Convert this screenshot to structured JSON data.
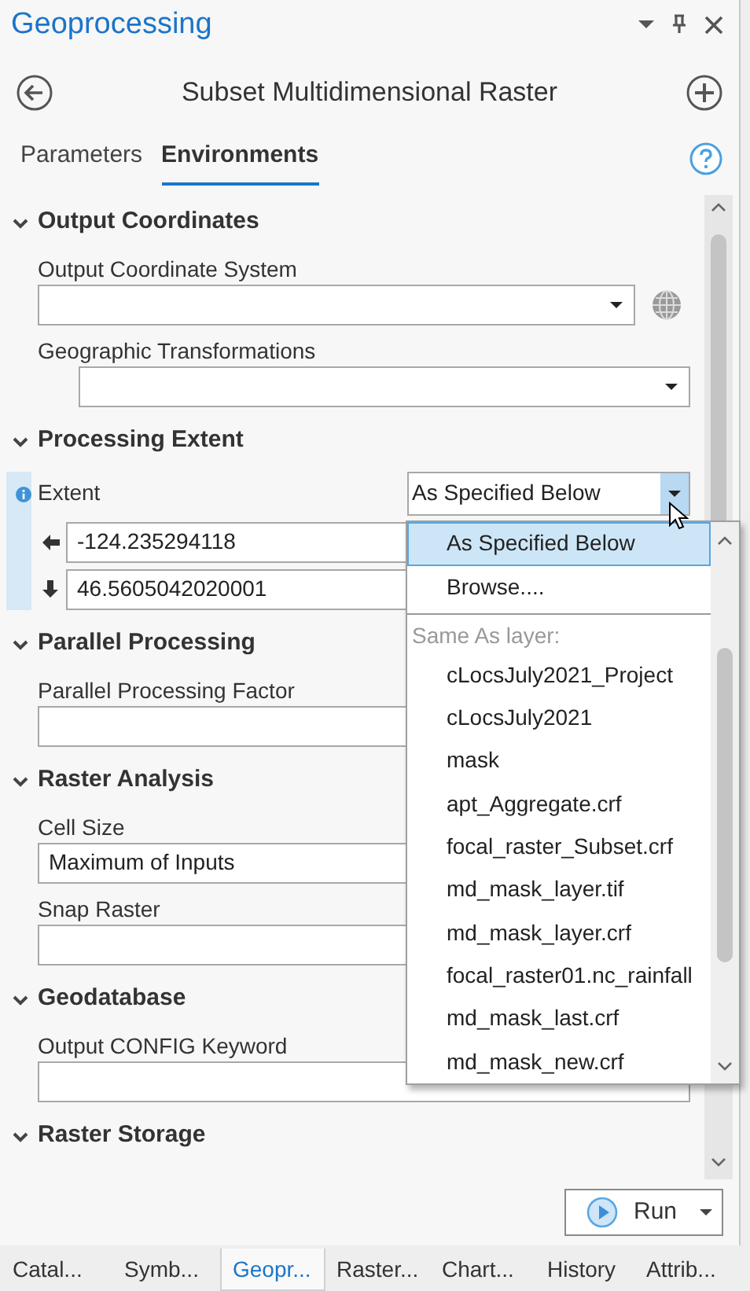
{
  "panel": {
    "title": "Geoprocessing"
  },
  "tool": {
    "title": "Subset Multidimensional Raster"
  },
  "tabs": [
    {
      "label": "Parameters",
      "selected": false
    },
    {
      "label": "Environments",
      "selected": true
    }
  ],
  "sections": [
    {
      "title": "Output Coordinates",
      "expanded": true,
      "fields": [
        {
          "kind": "dropdown",
          "label": "Output Coordinate System",
          "picker": true
        },
        {
          "kind": "dropdown",
          "label": "Geographic Transformations",
          "indented": true
        }
      ]
    },
    {
      "title": "Processing Extent",
      "expanded": true,
      "fields": [
        {
          "kind": "extent",
          "label": "Extent",
          "value": "As Specified Below",
          "open": true,
          "coordinates": [
            {
              "value": "-124.235294118"
            },
            {
              "value": "46.5605042020001"
            }
          ]
        }
      ]
    },
    {
      "title": "Parallel Processing",
      "expanded": true,
      "fields": [
        {
          "kind": "text",
          "label": "Parallel Processing Factor"
        }
      ]
    },
    {
      "title": "Raster Analysis",
      "expanded": true,
      "fields": [
        {
          "kind": "text",
          "label": "Cell Size",
          "value": "Maximum of Inputs"
        },
        {
          "kind": "text",
          "label": "Snap Raster"
        }
      ]
    },
    {
      "title": "Geodatabase",
      "expanded": true,
      "fields": [
        {
          "kind": "text",
          "label": "Output CONFIG Keyword"
        }
      ]
    },
    {
      "title": "Raster Storage",
      "expanded": true
    }
  ],
  "dropdown_list": {
    "items": [
      {
        "kind": "option",
        "label": "As Specified Below",
        "selected": true
      },
      {
        "kind": "option",
        "label": "Browse....",
        "selected": false
      },
      {
        "kind": "header",
        "label": "Same As layer:"
      },
      {
        "kind": "layer",
        "label": "cLocsJuly2021_Project",
        "selected": false
      },
      {
        "kind": "layer",
        "label": "cLocsJuly2021",
        "selected": false
      },
      {
        "kind": "layer",
        "label": "mask",
        "selected": false
      },
      {
        "kind": "layer",
        "label": "apt_Aggregate.crf",
        "selected": false
      },
      {
        "kind": "layer",
        "label": "focal_raster_Subset.crf",
        "selected": false
      },
      {
        "kind": "layer",
        "label": "md_mask_layer.tif",
        "selected": false
      },
      {
        "kind": "layer",
        "label": "md_mask_layer.crf",
        "selected": false
      },
      {
        "kind": "layer",
        "label": "focal_raster01.nc_rainfall",
        "selected": false
      },
      {
        "kind": "layer",
        "label": "md_mask_last.crf",
        "selected": false
      },
      {
        "kind": "layer",
        "label": "md_mask_new.crf",
        "selected": false
      }
    ]
  },
  "run_button": {
    "label": "Run"
  },
  "bottom_tabs": [
    {
      "label": "Catal...",
      "selected": false
    },
    {
      "label": "Symb...",
      "selected": false
    },
    {
      "label": "Geopr...",
      "selected": true
    },
    {
      "label": "Raster...",
      "selected": false
    },
    {
      "label": "Chart...",
      "selected": false
    },
    {
      "label": "History",
      "selected": false
    },
    {
      "label": "Attrib...",
      "selected": false
    }
  ]
}
